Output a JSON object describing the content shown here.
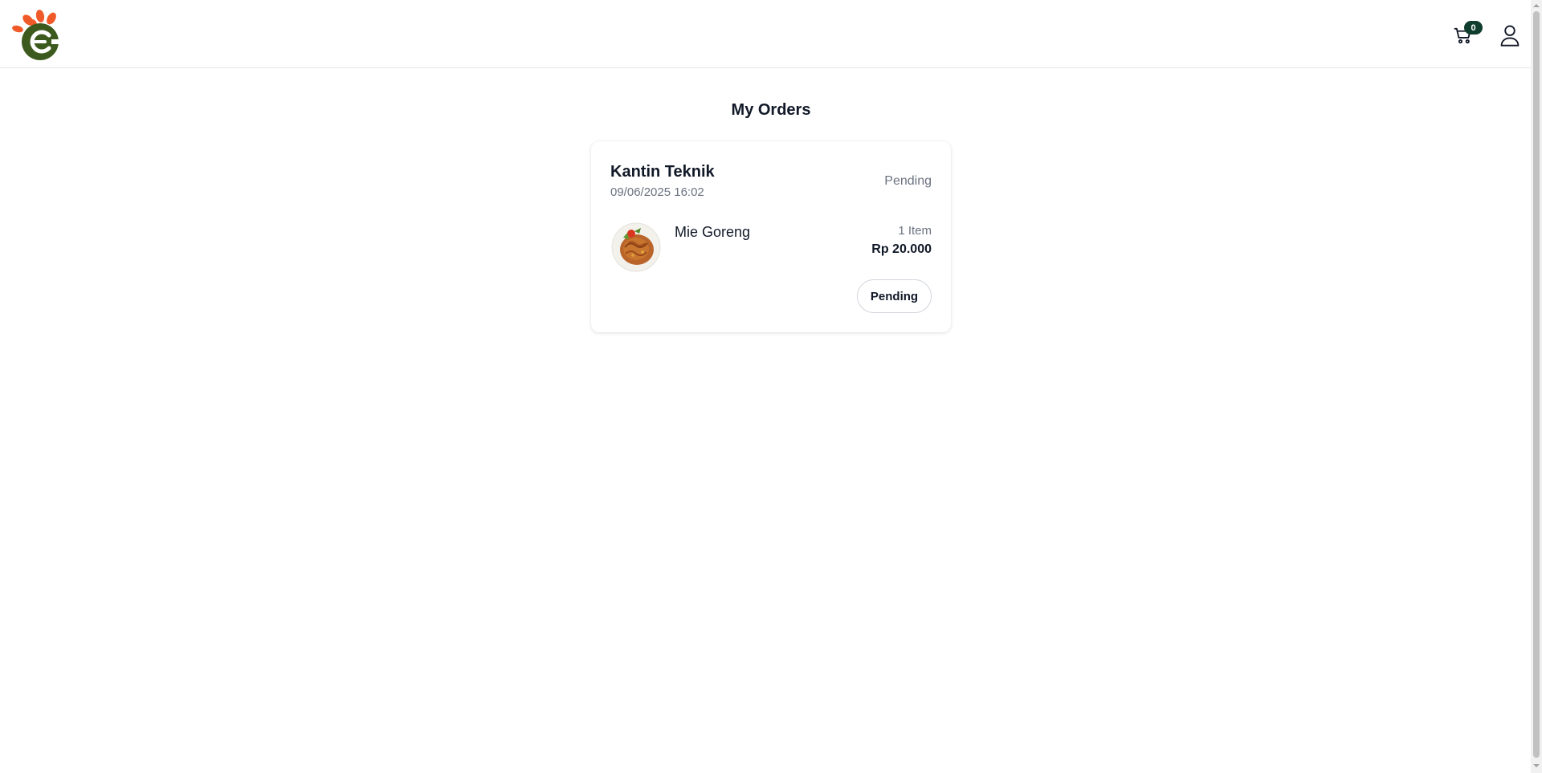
{
  "header": {
    "cart_count": "0"
  },
  "icons": {
    "logo": "brand-logo",
    "cart": "cart-icon",
    "user": "user-icon"
  },
  "page": {
    "title": "My Orders"
  },
  "orders": [
    {
      "canteen": "Kantin Teknik",
      "datetime": "09/06/2025 16:02",
      "status": "Pending",
      "items": [
        {
          "name": "Mie Goreng",
          "quantity": "1 Item",
          "price": "Rp 20.000"
        }
      ],
      "action_label": "Pending"
    }
  ],
  "colors": {
    "brand_green": "#3d5a1e",
    "brand_orange": "#f05a28",
    "badge": "#0f3d2e",
    "muted_text": "#6b7280"
  }
}
